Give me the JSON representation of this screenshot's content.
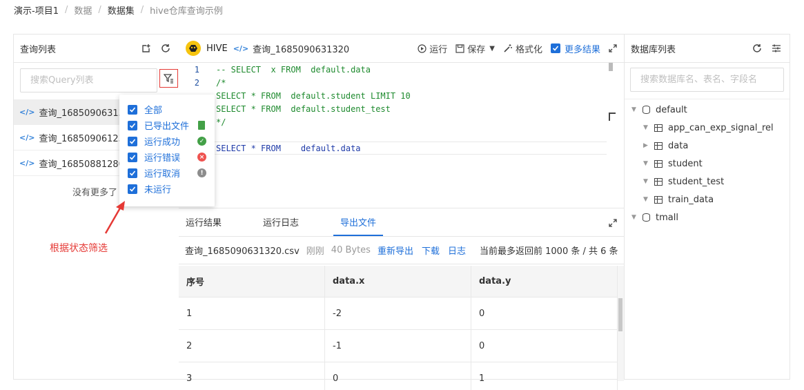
{
  "breadcrumb": [
    {
      "label": "演示-项目1",
      "muted": false
    },
    {
      "label": "数据",
      "muted": true
    },
    {
      "label": "数据集",
      "muted": false
    },
    {
      "label": "hive仓库查询示例",
      "muted": true
    }
  ],
  "left_panel": {
    "title": "查询列表",
    "search_placeholder": "搜索Query列表",
    "items": [
      "查询_1685090631320",
      "查询_1685090612308",
      "查询_1685088128053"
    ],
    "no_more": "没有更多了"
  },
  "filter_dropdown": {
    "options": [
      {
        "label": "全部",
        "status": "none",
        "color": ""
      },
      {
        "label": "已导出文件",
        "status": "file-icon",
        "color": "#43a047"
      },
      {
        "label": "运行成功",
        "status": "check-icon",
        "color": "#43a047"
      },
      {
        "label": "运行错误",
        "status": "error-icon",
        "color": "#ef5350"
      },
      {
        "label": "运行取消",
        "status": "cancel-icon",
        "color": "#8c8c8c"
      },
      {
        "label": "未运行",
        "status": "none",
        "color": ""
      }
    ]
  },
  "annotation": "根据状态筛选",
  "editor_header": {
    "engine": "HIVE",
    "tab_title": "查询_1685090631320",
    "run": "运行",
    "save": "保存",
    "format": "格式化",
    "more_results": "更多结果"
  },
  "editor": {
    "lines": [
      {
        "no": "1",
        "text": "-- SELECT  x FROM  default.data",
        "kind": "comment"
      },
      {
        "no": "2",
        "text": "/*",
        "kind": "comment"
      },
      {
        "no": "3",
        "text": "SELECT * FROM  default.student LIMIT 10",
        "kind": "comment"
      },
      {
        "no": "4",
        "text": "SELECT * FROM  default.student_test",
        "kind": "comment"
      },
      {
        "no": "5",
        "text": "*/",
        "kind": "comment"
      },
      {
        "no": "6",
        "text": "",
        "kind": "plain"
      },
      {
        "no": "7",
        "text": "SELECT * FROM    default.data",
        "kind": "cur"
      }
    ]
  },
  "result_tabs": [
    "运行结果",
    "运行日志",
    "导出文件"
  ],
  "export": {
    "filename": "查询_1685090631320.csv",
    "time": "刚刚",
    "size": "40 Bytes",
    "re_export": "重新导出",
    "download": "下载",
    "log": "日志",
    "info": "当前最多返回前 1000 条 / 共 6 条"
  },
  "table": {
    "columns": [
      "序号",
      "data.x",
      "data.y"
    ],
    "rows": [
      [
        "1",
        "-2",
        "0"
      ],
      [
        "2",
        "-1",
        "0"
      ],
      [
        "3",
        "0",
        "1"
      ]
    ]
  },
  "right_panel": {
    "title": "数据库列表",
    "search_placeholder": "搜索数据库名、表名、字段名",
    "tree": [
      {
        "label": "default",
        "type": "db",
        "level": 0,
        "caret": "down"
      },
      {
        "label": "app_can_exp_signal_rel",
        "type": "table",
        "level": 1,
        "caret": "down"
      },
      {
        "label": "data",
        "type": "table",
        "level": 1,
        "caret": "right"
      },
      {
        "label": "student",
        "type": "table",
        "level": 1,
        "caret": "down"
      },
      {
        "label": "student_test",
        "type": "table",
        "level": 1,
        "caret": "down"
      },
      {
        "label": "train_data",
        "type": "table",
        "level": 1,
        "caret": "down"
      },
      {
        "label": "tmall",
        "type": "db",
        "level": 0,
        "caret": "down"
      }
    ]
  },
  "colors": {
    "accent": "#1e6fd9",
    "annotation": "#e53935",
    "hive": "#f6c40f"
  }
}
